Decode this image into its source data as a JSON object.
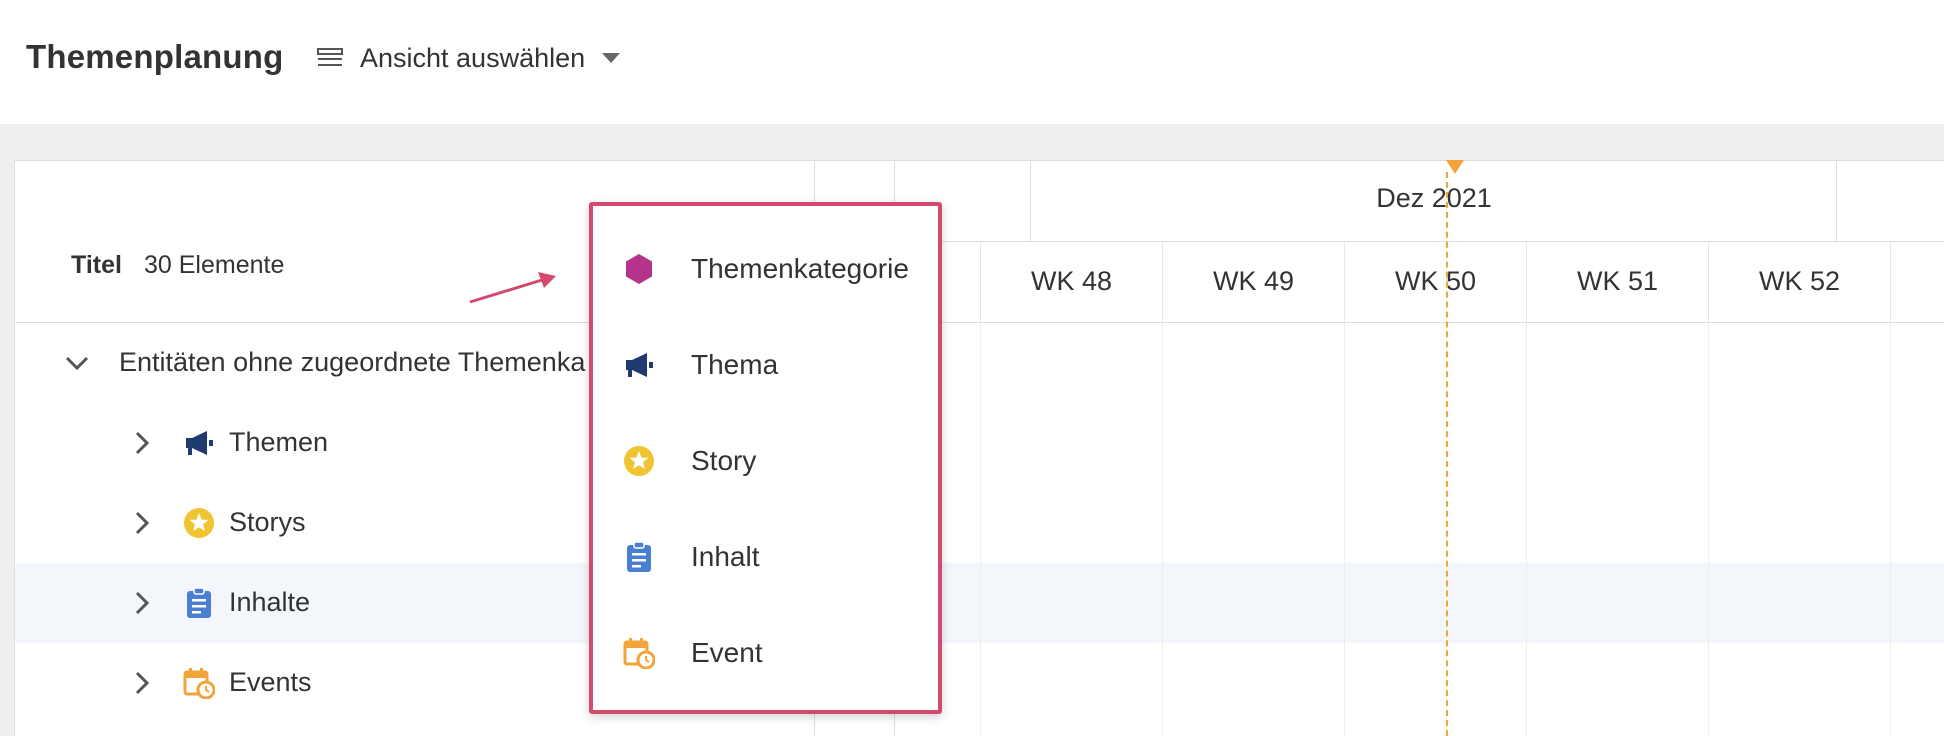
{
  "header": {
    "title": "Themenplanung",
    "view_selector_label": "Ansicht auswählen",
    "view_selector_icon": "view-list-icon",
    "caret_icon": "caret-down-icon"
  },
  "list": {
    "title_label": "Titel",
    "count_label": "30 Elemente",
    "group": {
      "label": "Entitäten ohne zugeordnete Themenkategorie",
      "visible_label": "Entitäten ohne zugeordnete Themenka"
    },
    "rows": [
      {
        "label": "Themen",
        "icon": "megaphone-icon"
      },
      {
        "label": "Storys",
        "icon": "star-circle-icon"
      },
      {
        "label": "Inhalte",
        "icon": "clipboard-icon"
      },
      {
        "label": "Events",
        "icon": "calendar-clock-icon"
      }
    ]
  },
  "timeline": {
    "month": "Dez 2021",
    "weeks": [
      "WK 48",
      "WK 49",
      "WK 50",
      "WK 51",
      "WK 52"
    ]
  },
  "popup_menu": {
    "items": [
      {
        "label": "Themenkategorie",
        "icon": "hexagon-icon"
      },
      {
        "label": "Thema",
        "icon": "megaphone-icon"
      },
      {
        "label": "Story",
        "icon": "star-circle-icon"
      },
      {
        "label": "Inhalt",
        "icon": "clipboard-icon"
      },
      {
        "label": "Event",
        "icon": "calendar-clock-icon"
      }
    ]
  },
  "colors": {
    "accent_popup_border": "#d44a6f",
    "today_line": "#f2a33a",
    "hexagon": "#b5338a",
    "megaphone": "#1f3a6e",
    "star": "#f0c430",
    "clipboard": "#4a7fd1",
    "calendar": "#f2a33a",
    "row_highlight": "#f3f7fc",
    "canvas": "#eeeeee"
  }
}
